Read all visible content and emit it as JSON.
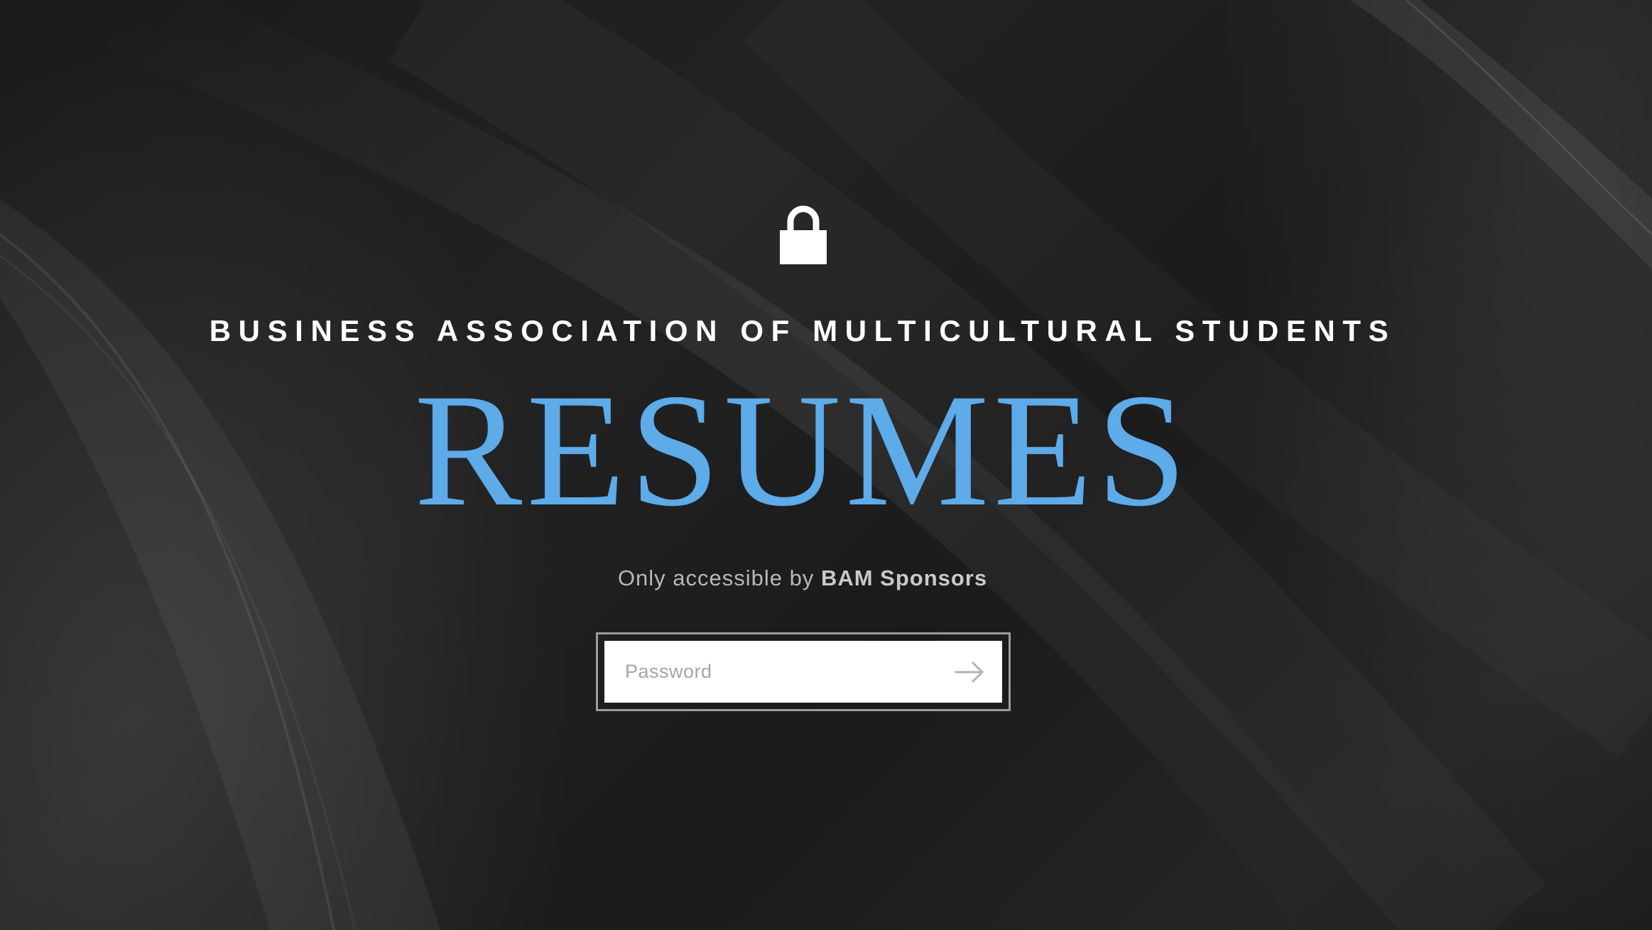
{
  "header": {
    "lock_icon": "lock-icon",
    "organization": "BUSINESS ASSOCIATION OF MULTICULTURAL STUDENTS",
    "title": "RESUMES"
  },
  "access_note": {
    "prefix": "Only accessible by",
    "audience": "BAM Sponsors"
  },
  "password_form": {
    "placeholder": "Password",
    "value": "",
    "submit_icon": "arrow-right-icon"
  },
  "colors": {
    "background": "#1c1c1d",
    "title_accent": "#5dabe8",
    "heading": "#ffffff",
    "note_text": "#b8b8b8",
    "input_border": "#9c9c9c"
  }
}
